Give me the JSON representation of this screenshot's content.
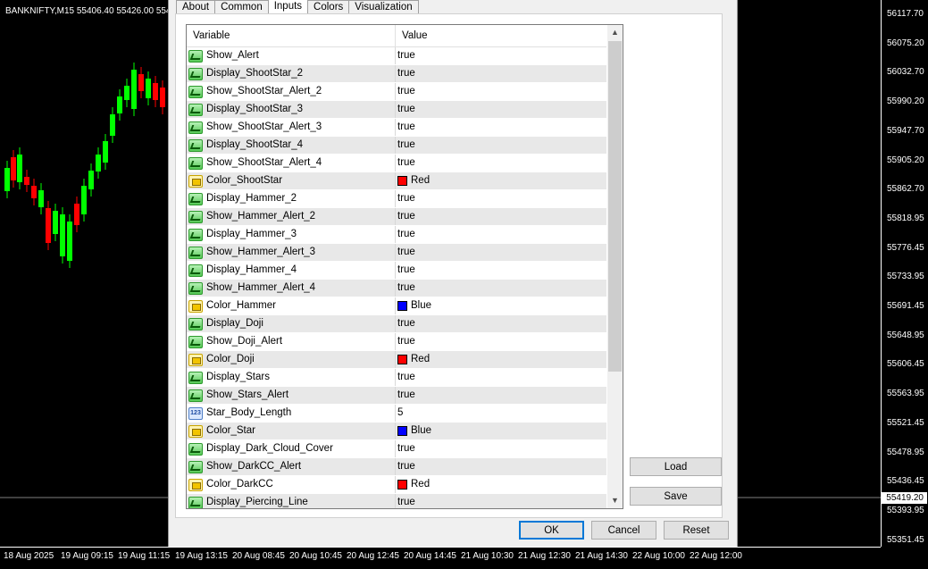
{
  "chart": {
    "title": "BANKNIFTY,M15  55406.40 55426.00 554",
    "current_price": "55419.20",
    "price_labels": [
      "56117.70",
      "56075.20",
      "56032.70",
      "55990.20",
      "55947.70",
      "55905.20",
      "55862.70",
      "55818.95",
      "55776.45",
      "55733.95",
      "55691.45",
      "55648.95",
      "55606.45",
      "55563.95",
      "55521.45",
      "55478.95",
      "55436.45",
      "55393.95",
      "55351.45"
    ],
    "time_labels": [
      "18 Aug 2025",
      "19 Aug 09:15",
      "19 Aug 11:15",
      "19 Aug 13:15",
      "20 Aug 08:45",
      "20 Aug 10:45",
      "20 Aug 12:45",
      "20 Aug 14:45",
      "21 Aug 10:30",
      "21 Aug 12:30",
      "21 Aug 14:30",
      "22 Aug 10:00",
      "22 Aug 12:00"
    ],
    "bull_color": "#00ff00",
    "bear_color": "#ff0000"
  },
  "dialog": {
    "tabs": [
      "About",
      "Common",
      "Inputs",
      "Colors",
      "Visualization"
    ],
    "active_tab": "Inputs",
    "grid": {
      "col_variable": "Variable",
      "col_value": "Value",
      "rows": [
        {
          "type": "bool",
          "name": "Show_Alert",
          "value": "true"
        },
        {
          "type": "bool",
          "name": "Display_ShootStar_2",
          "value": "true"
        },
        {
          "type": "bool",
          "name": "Show_ShootStar_Alert_2",
          "value": "true"
        },
        {
          "type": "bool",
          "name": "Display_ShootStar_3",
          "value": "true"
        },
        {
          "type": "bool",
          "name": "Show_ShootStar_Alert_3",
          "value": "true"
        },
        {
          "type": "bool",
          "name": "Display_ShootStar_4",
          "value": "true"
        },
        {
          "type": "bool",
          "name": "Show_ShootStar_Alert_4",
          "value": "true"
        },
        {
          "type": "color",
          "name": "Color_ShootStar",
          "value": "Red",
          "swatch": "#ff0000"
        },
        {
          "type": "bool",
          "name": "Display_Hammer_2",
          "value": "true"
        },
        {
          "type": "bool",
          "name": "Show_Hammer_Alert_2",
          "value": "true"
        },
        {
          "type": "bool",
          "name": "Display_Hammer_3",
          "value": "true"
        },
        {
          "type": "bool",
          "name": "Show_Hammer_Alert_3",
          "value": "true"
        },
        {
          "type": "bool",
          "name": "Display_Hammer_4",
          "value": "true"
        },
        {
          "type": "bool",
          "name": "Show_Hammer_Alert_4",
          "value": "true"
        },
        {
          "type": "color",
          "name": "Color_Hammer",
          "value": "Blue",
          "swatch": "#0000ff"
        },
        {
          "type": "bool",
          "name": "Display_Doji",
          "value": "true"
        },
        {
          "type": "bool",
          "name": "Show_Doji_Alert",
          "value": "true"
        },
        {
          "type": "color",
          "name": "Color_Doji",
          "value": "Red",
          "swatch": "#ff0000"
        },
        {
          "type": "bool",
          "name": "Display_Stars",
          "value": "true"
        },
        {
          "type": "bool",
          "name": "Show_Stars_Alert",
          "value": "true"
        },
        {
          "type": "num",
          "name": "Star_Body_Length",
          "value": "5"
        },
        {
          "type": "color",
          "name": "Color_Star",
          "value": "Blue",
          "swatch": "#0000ff"
        },
        {
          "type": "bool",
          "name": "Display_Dark_Cloud_Cover",
          "value": "true"
        },
        {
          "type": "bool",
          "name": "Show_DarkCC_Alert",
          "value": "true"
        },
        {
          "type": "color",
          "name": "Color_DarkCC",
          "value": "Red",
          "swatch": "#ff0000"
        },
        {
          "type": "bool",
          "name": "Display_Piercing_Line",
          "value": "true"
        }
      ]
    },
    "buttons": {
      "load": "Load",
      "save": "Save",
      "ok": "OK",
      "cancel": "Cancel",
      "reset": "Reset"
    },
    "num_icon_text": "123"
  }
}
